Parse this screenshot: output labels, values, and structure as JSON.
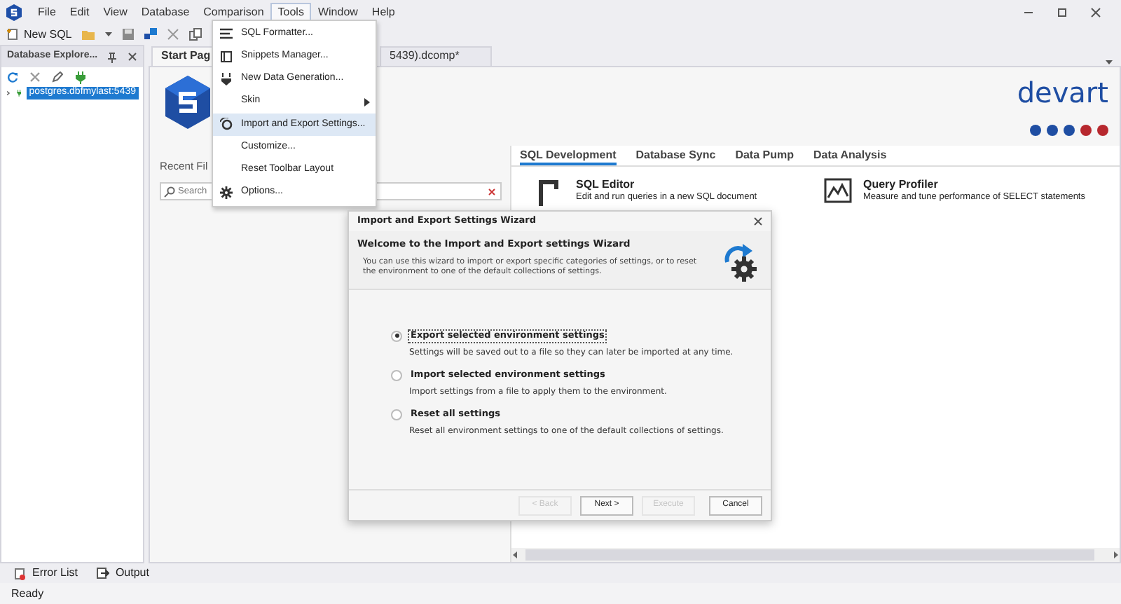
{
  "title_bar": {
    "menus": [
      {
        "label": "File",
        "selected": false
      },
      {
        "label": "Edit",
        "selected": false
      },
      {
        "label": "View",
        "selected": false
      },
      {
        "label": "Database",
        "selected": false
      },
      {
        "label": "Comparison",
        "selected": false
      },
      {
        "label": "Tools",
        "selected": true
      },
      {
        "label": "Window",
        "selected": false
      },
      {
        "label": "Help",
        "selected": false
      }
    ]
  },
  "toolbar": {
    "new_sql": "New SQL"
  },
  "tools_menu": [
    {
      "kind": "formatter",
      "label": "SQL Formatter...",
      "highlighted": false
    },
    {
      "kind": "snippets",
      "label": "Snippets Manager...",
      "highlighted": false
    },
    {
      "kind": "datagen",
      "label": "New Data Generation...",
      "highlighted": false
    },
    {
      "kind": "submenu",
      "label": "Skin",
      "highlighted": false
    },
    {
      "kind": "importexport",
      "label": "Import and Export Settings...",
      "highlighted": true
    },
    {
      "kind": "plain",
      "label": "Customize...",
      "highlighted": false
    },
    {
      "kind": "plain",
      "label": "Reset Toolbar Layout",
      "highlighted": false
    },
    {
      "kind": "options",
      "label": "Options...",
      "highlighted": false
    }
  ],
  "database_explorer": {
    "title": "Database Explore...",
    "tree": [
      {
        "label": "postgres.dbfmylast:5439",
        "selected": true,
        "expanded": false
      }
    ]
  },
  "document_tabs": [
    {
      "label": "Start Pag",
      "selected": true
    },
    {
      "label": "5439).dcomp*",
      "selected": false
    }
  ],
  "start_page": {
    "brand": "devart",
    "recent_files_title": "Recent Fil",
    "search": {
      "placeholder": "Search"
    },
    "tabs": [
      {
        "label": "SQL Development",
        "selected": true
      },
      {
        "label": "Database Sync",
        "selected": false
      },
      {
        "label": "Data Pump",
        "selected": false
      },
      {
        "label": "Data Analysis",
        "selected": false
      }
    ],
    "tools": [
      {
        "kind": "editor",
        "title": "SQL Editor",
        "description": "Edit and run queries in a new SQL document"
      },
      {
        "kind": "profiler",
        "title": "Query Profiler",
        "description": "Measure and tune performance of SELECT statements"
      }
    ]
  },
  "dialog": {
    "title": "Import and Export Settings Wizard",
    "heading": "Welcome to the Import and Export settings Wizard",
    "description": "You can use this wizard to import or export specific categories of settings, or to reset the environment to one of the default collections of settings.",
    "options": [
      {
        "label": "Export selected environment settings",
        "description": "Settings will be saved out to a file so they can later be imported at any time.",
        "selected": true
      },
      {
        "label": "Import selected environment settings",
        "description": "Import settings from a file to apply them to the environment.",
        "selected": false
      },
      {
        "label": "Reset all settings",
        "description": "Reset all environment settings to one of the default collections of settings.",
        "selected": false
      }
    ],
    "buttons": [
      {
        "label": "< Back",
        "disabled": true
      },
      {
        "label": "Next >",
        "disabled": false
      },
      {
        "label": "Execute",
        "disabled": true
      },
      {
        "label": "Cancel",
        "disabled": false
      }
    ]
  },
  "bottom_tabs": [
    {
      "kind": "errors",
      "label": "Error List"
    },
    {
      "kind": "output",
      "label": "Output"
    }
  ],
  "status_bar": {
    "text": "Ready"
  }
}
